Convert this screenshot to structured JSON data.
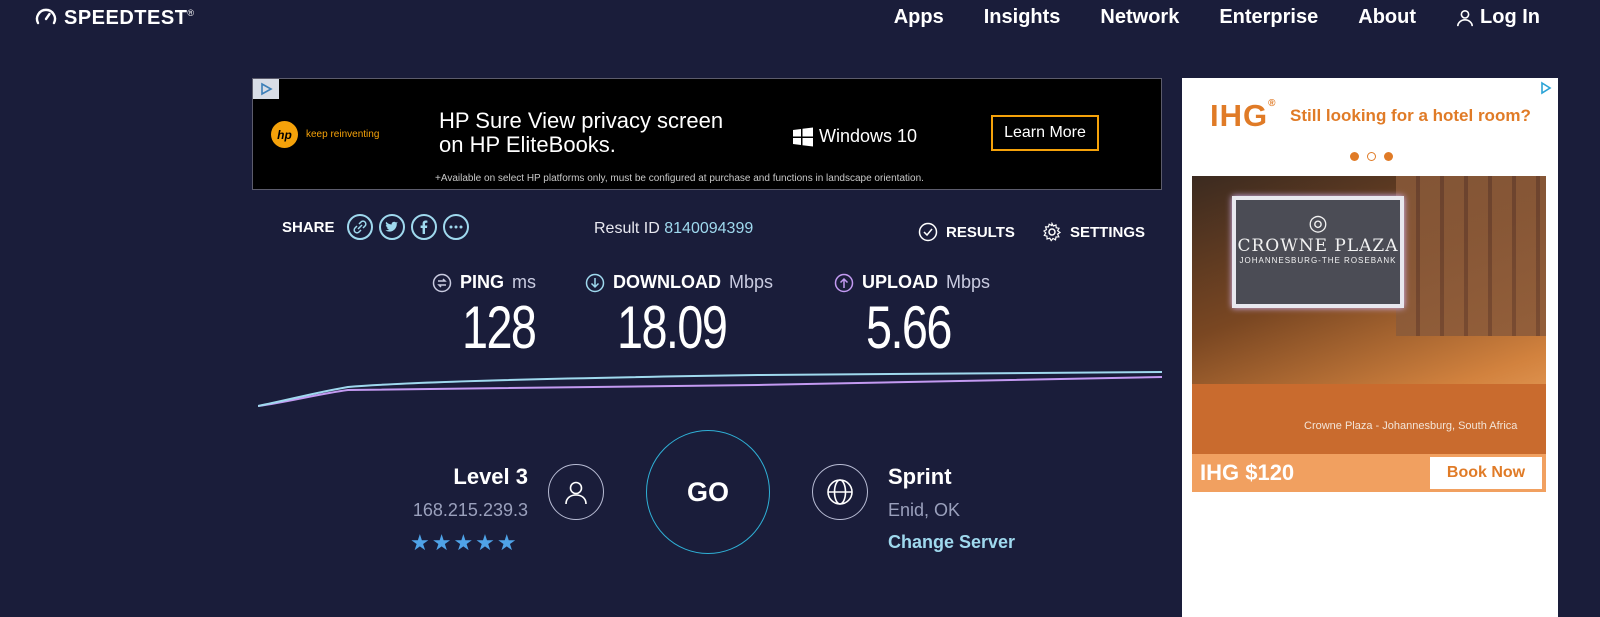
{
  "brand": {
    "name": "SPEEDTEST",
    "trademark": "®"
  },
  "nav": [
    {
      "label": "Apps"
    },
    {
      "label": "Insights"
    },
    {
      "label": "Network"
    },
    {
      "label": "Enterprise"
    },
    {
      "label": "About"
    },
    {
      "label": "Log In",
      "icon": "user-icon"
    }
  ],
  "ad_top": {
    "brand_logo": "hp",
    "tagline": "keep reinventing",
    "headline_line1": "HP Sure View privacy screen",
    "headline_line2": "on HP EliteBooks.",
    "os_label": "Windows 10",
    "cta": "Learn More",
    "fine_print": "+Available on select HP platforms only, must be configured at purchase and functions in landscape orientation."
  },
  "share": {
    "label": "SHARE",
    "icons": [
      "link-icon",
      "twitter-icon",
      "facebook-icon",
      "more-icon"
    ]
  },
  "result": {
    "label": "Result ID",
    "id": "8140094399"
  },
  "actions": {
    "results": "RESULTS",
    "settings": "SETTINGS"
  },
  "metrics": {
    "ping": {
      "label": "PING",
      "unit": "ms",
      "value": "128"
    },
    "download": {
      "label": "DOWNLOAD",
      "unit": "Mbps",
      "value": "18.09"
    },
    "upload": {
      "label": "UPLOAD",
      "unit": "Mbps",
      "value": "5.66"
    }
  },
  "colors": {
    "background": "#1a1d3a",
    "download": "#9fd9ee",
    "upload": "#c39af2",
    "accent": "#2fb0d6",
    "stars": "#4fa3e8"
  },
  "isp": {
    "name": "Level 3",
    "ip": "168.215.239.3",
    "rating": 5,
    "stars": "★★★★★"
  },
  "go_label": "GO",
  "server": {
    "name": "Sprint",
    "location": "Enid, OK",
    "change_label": "Change Server"
  },
  "ad_right": {
    "logo": "IHG",
    "registered": "®",
    "tagline": "Still looking for a hotel room?",
    "sign_line1": "CROWNE PLAZA",
    "sign_line2": "JOHANNESBURG-THE ROSEBANK",
    "photo_caption": "Crowne Plaza - Johannesburg, South Africa",
    "price": "IHG $120",
    "cta": "Book Now"
  }
}
